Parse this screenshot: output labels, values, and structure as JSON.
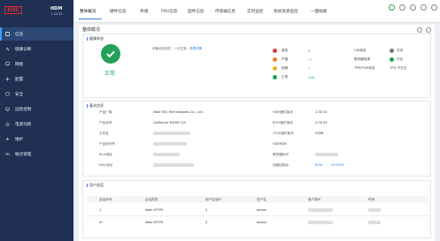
{
  "app": {
    "logo": "H3C",
    "name": "HDM",
    "version": "1.30.32"
  },
  "sidebar": {
    "items": [
      {
        "label": "信息",
        "icon": "info-icon",
        "active": true
      },
      {
        "label": "健康诊断",
        "icon": "health-icon"
      },
      {
        "label": "网络",
        "icon": "network-icon"
      },
      {
        "label": "配置",
        "icon": "config-icon"
      },
      {
        "label": "安全",
        "icon": "shield-icon"
      },
      {
        "label": "远程控制",
        "icon": "remote-icon"
      },
      {
        "label": "电源功耗",
        "icon": "power-icon"
      },
      {
        "label": "维护",
        "icon": "maintenance-icon"
      },
      {
        "label": "联合管理",
        "icon": "federation-icon"
      }
    ]
  },
  "tabs": [
    "整体概况",
    "硬件信息",
    "存储",
    "FRU信息",
    "固件信息",
    "传感器信息",
    "实时监控",
    "系统资源监控",
    "一键收集"
  ],
  "page": {
    "title": "整体概况"
  },
  "health": {
    "section_title": "健康状态",
    "status": "正常",
    "description": "设备状态良好，一切正常。",
    "link": "查看详情"
  },
  "alarms": [
    {
      "name": "紧急",
      "count": "0",
      "color": "#e03a3a"
    },
    {
      "name": "严重",
      "count": "17",
      "color": "#f07b23"
    },
    {
      "name": "轻微",
      "count": "0",
      "color": "#f2b51c"
    },
    {
      "name": "正常",
      "count": "118",
      "color": "#23a05a"
    }
  ],
  "status_items": [
    {
      "name": "UID状态",
      "value": "关闭"
    },
    {
      "name": "服务器电源",
      "value": "开启"
    },
    {
      "name": "TPM/TCM状态",
      "value": "TPM 不在位"
    }
  ],
  "basic": {
    "section_title": "基本信息",
    "left": [
      {
        "label": "产品厂商",
        "value": "New H3C Technologies Co., Ltd."
      },
      {
        "label": "产品名称",
        "value": "UniServer R4900 G3"
      },
      {
        "label": "主机名",
        "value": ""
      },
      {
        "label": "产品序列号",
        "value": ""
      },
      {
        "label": "IPv4地址",
        "value": ""
      },
      {
        "label": "MAC地址",
        "value": ""
      }
    ],
    "right": [
      {
        "label": "HDM固件版本",
        "value": "1.30.32"
      },
      {
        "label": "BIOS固件版本",
        "value": "2.00.52"
      },
      {
        "label": "CPLD固件版本",
        "value": "V008"
      },
      {
        "label": "HDM时间",
        "value": ""
      },
      {
        "label": "服务器标识",
        "value": ""
      },
      {
        "label": "远程控制台",
        "value": "KVM",
        "value2": "H5 KVM"
      }
    ]
  },
  "sessions": {
    "section_title": "用户会话",
    "columns": [
      "会话序号",
      "会话类型",
      "用户会话ID",
      "用户名",
      "客户端IP",
      "时间"
    ],
    "rows": [
      [
        "1",
        "Web HTTPS",
        "2",
        "admin"
      ],
      [
        "4*",
        "Web HTTPS",
        "2",
        "admin"
      ]
    ]
  },
  "colors": {
    "accent": "#2f7de1",
    "sidebar": "#1f3052",
    "ok": "#23a05a"
  }
}
